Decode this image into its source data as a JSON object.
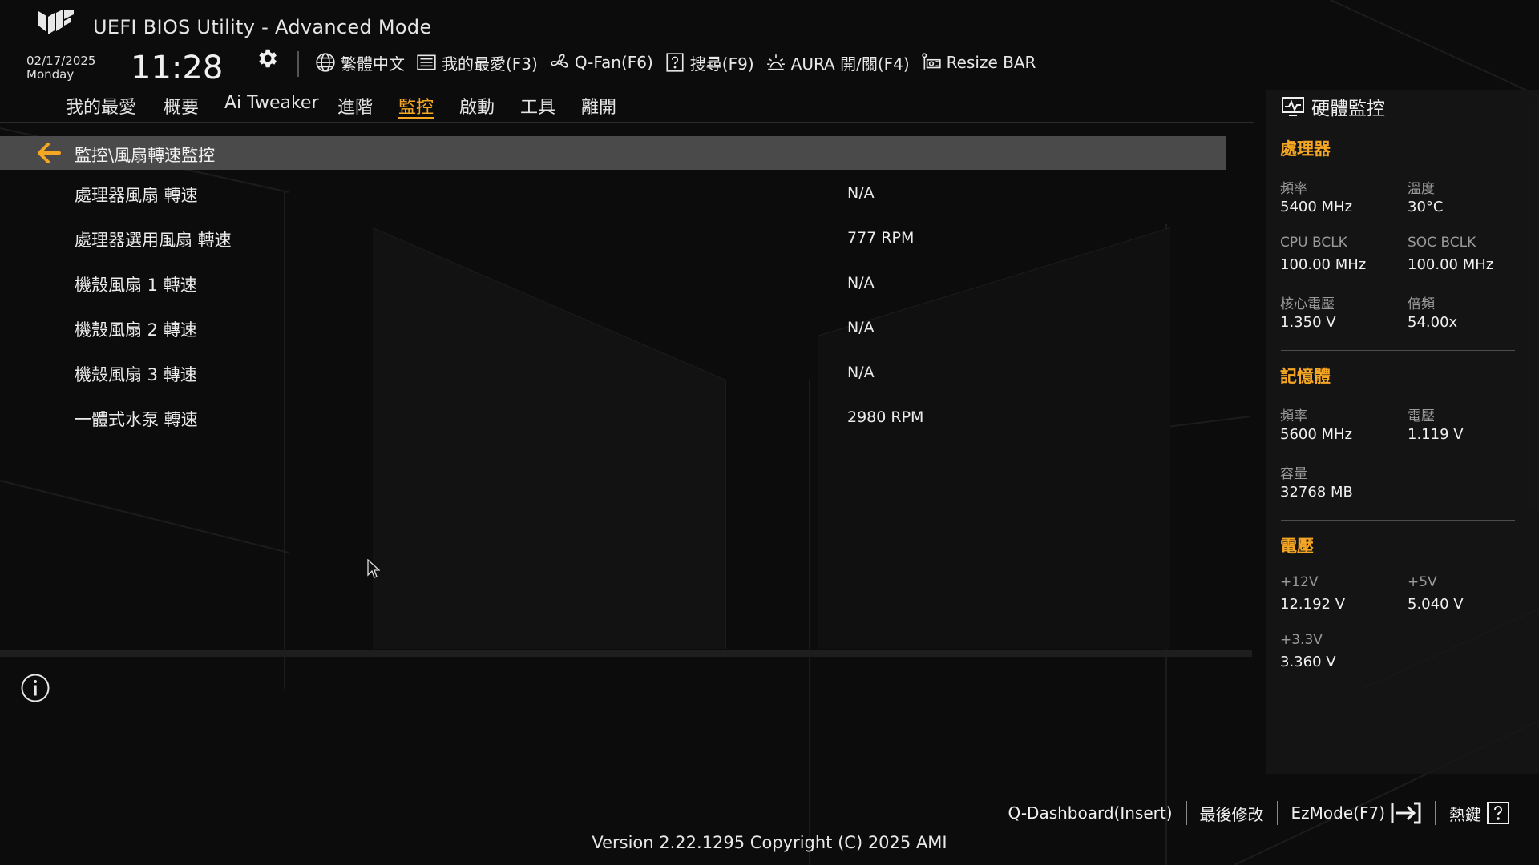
{
  "header": {
    "title": "UEFI BIOS Utility - Advanced Mode",
    "date": "02/17/2025",
    "weekday": "Monday",
    "time": "11:28"
  },
  "toolbar": {
    "language": "繁體中文",
    "favorites": "我的最愛(F3)",
    "qfan": "Q-Fan(F6)",
    "search": "搜尋(F9)",
    "aura": "AURA 開/關(F4)",
    "resize_bar": "Resize BAR"
  },
  "nav": {
    "tabs": [
      "我的最愛",
      "概要",
      "Ai Tweaker",
      "進階",
      "監控",
      "啟動",
      "工具",
      "離開"
    ],
    "active": "監控"
  },
  "breadcrumb": "監控\\風扇轉速監控",
  "fan_rows": [
    {
      "label": "處理器風扇 轉速",
      "value": "N/A"
    },
    {
      "label": "處理器選用風扇 轉速",
      "value": "777 RPM"
    },
    {
      "label": "機殼風扇 1 轉速",
      "value": "N/A"
    },
    {
      "label": "機殼風扇 2 轉速",
      "value": "N/A"
    },
    {
      "label": "機殼風扇 3 轉速",
      "value": "N/A"
    },
    {
      "label": "一體式水泵 轉速",
      "value": "2980 RPM"
    }
  ],
  "hw_monitor": {
    "title": "硬體監控",
    "cpu": {
      "heading": "處理器",
      "freq_label": "頻率",
      "freq": "5400 MHz",
      "temp_label": "溫度",
      "temp": "30°C",
      "bclk_label": "CPU BCLK",
      "bclk": "100.00 MHz",
      "soc_label": "SOC BCLK",
      "soc": "100.00 MHz",
      "vcore_label": "核心電壓",
      "vcore": "1.350 V",
      "ratio_label": "倍頻",
      "ratio": "54.00x"
    },
    "memory": {
      "heading": "記憶體",
      "freq_label": "頻率",
      "freq": "5600 MHz",
      "volt_label": "電壓",
      "volt": "1.119 V",
      "cap_label": "容量",
      "cap": "32768 MB"
    },
    "voltage": {
      "heading": "電壓",
      "v12_label": "+12V",
      "v12": "12.192 V",
      "v5_label": "+5V",
      "v5": "5.040 V",
      "v33_label": "+3.3V",
      "v33": "3.360 V"
    }
  },
  "footer": {
    "qdashboard": "Q-Dashboard(Insert)",
    "last_modified": "最後修改",
    "ezmode": "EzMode(F7)",
    "hotkeys": "熱鍵",
    "version": "Version 2.22.1295 Copyright (C) 2025 AMI"
  },
  "colors": {
    "accent": "#f5a623",
    "background": "#0c0c0c",
    "breadcrumb_bg": "#4a4a4a"
  }
}
